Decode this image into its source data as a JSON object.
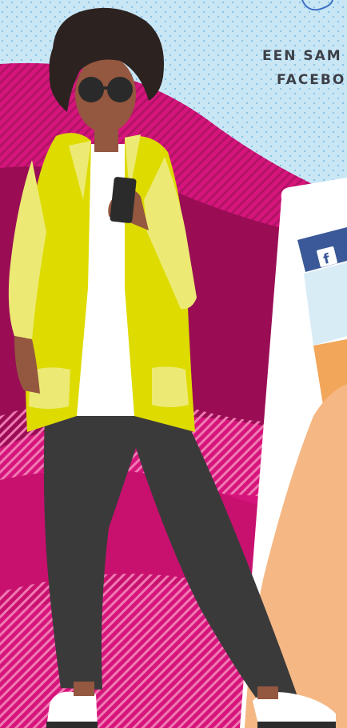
{
  "headline": {
    "line1": "EEN SAM",
    "line2": "FACEBO"
  },
  "phone": {
    "app_icon": "facebook-icon",
    "app_icon_glyph": "f"
  },
  "illustration": {
    "figure": "woman-with-phone",
    "background": "dotted-sky-and-pink-waves"
  },
  "colors": {
    "sky": "#c9e6f5",
    "sky_dots": "#7fc0e6",
    "magenta": "#d6157c",
    "dark_magenta": "#9a0d55",
    "pink_stripe": "#ec5aa3",
    "blazer": "#dedb00",
    "blazer_light": "#ecea74",
    "skin": "#94573f",
    "hair": "#2c2220",
    "trousers": "#3b3a3b",
    "shirt": "#ffffff",
    "hand_skin": "#f5b884",
    "facebook_blue": "#3b5998",
    "text": "#3c3f47"
  }
}
